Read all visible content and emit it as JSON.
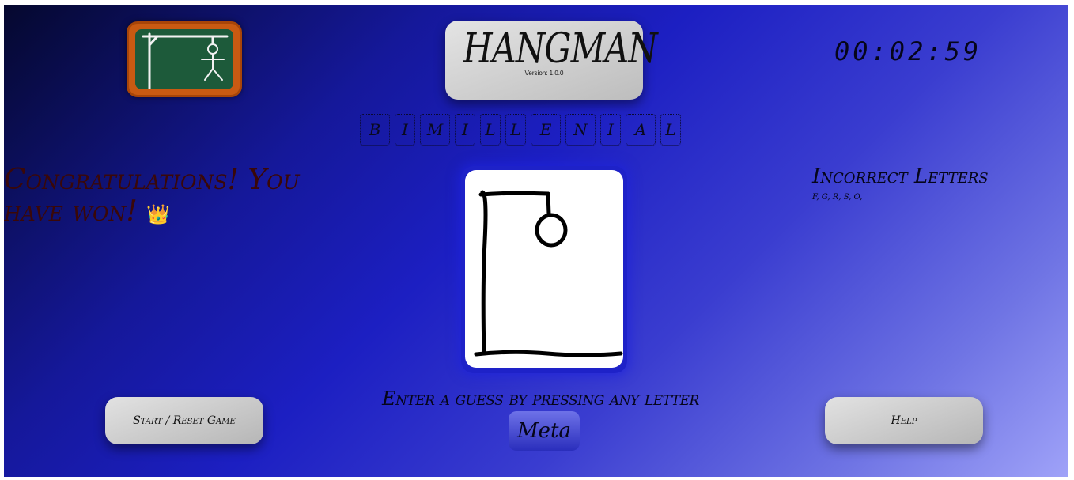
{
  "header": {
    "title": "HANGMAN",
    "version": "Version: 1.0.0",
    "timer": "00:02:59"
  },
  "word": {
    "letters": [
      "B",
      "I",
      "M",
      "I",
      "L",
      "L",
      "E",
      "N",
      "I",
      "A",
      "L"
    ]
  },
  "status": {
    "message": "Congratulations! You have won!",
    "emoji": "👑"
  },
  "incorrect": {
    "title": "Incorrect Letters",
    "letters": "F, G, R, S, O,"
  },
  "controls": {
    "prompt": "Enter a guess by pressing any letter",
    "meta_label": "Meta",
    "start_label": "Start / Reset Game",
    "help_label": "Help"
  },
  "icons": {
    "logo": "hangman-chalkboard-logo"
  },
  "colors": {
    "gallows_frame": "#1e22c8",
    "win_text": "#3a0808",
    "logo_frame": "#c95a12"
  }
}
